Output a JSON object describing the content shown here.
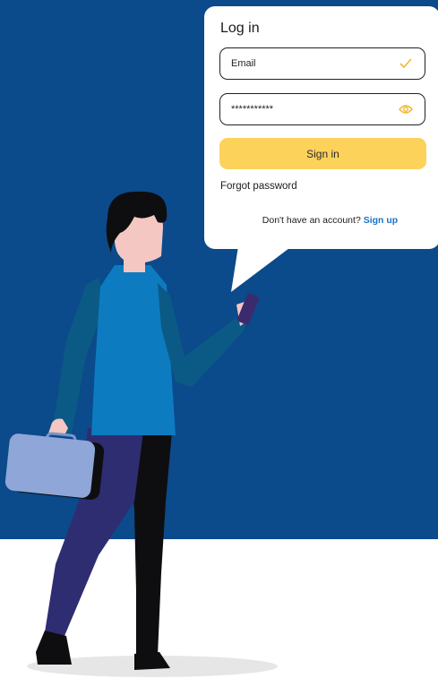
{
  "login": {
    "title": "Log in",
    "email_placeholder": "Email",
    "password_value": "***********",
    "signin_label": "Sign in",
    "forgot_label": "Forgot password",
    "signup_prompt": "Don't have an account?",
    "signup_link": "Sign up"
  },
  "icons": {
    "email_status": "checkmark-icon",
    "password_toggle": "eye-icon"
  },
  "colors": {
    "background": "#0b4a8b",
    "accent": "#fdd25b",
    "link": "#1a73c8"
  }
}
